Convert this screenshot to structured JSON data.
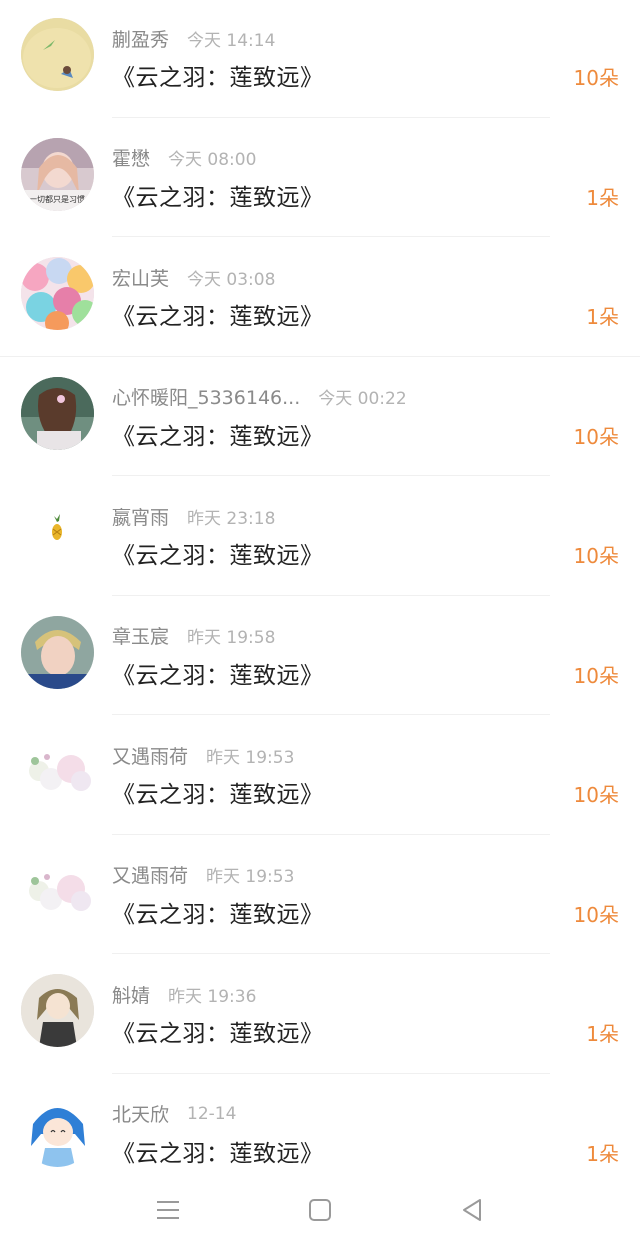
{
  "items": [
    {
      "name": "蒯盈秀",
      "time": "今天 14:14",
      "book": "《云之羽：莲致远》",
      "amount": "10朵",
      "avatar": "avatar-yellow-photo-icon"
    },
    {
      "name": "霍懋",
      "time": "今天 08:00",
      "book": "《云之羽：莲致远》",
      "amount": "1朵",
      "avatar": "avatar-girl-photo-icon"
    },
    {
      "name": "宏山芙",
      "time": "今天 03:08",
      "book": "《云之羽：莲致远》",
      "amount": "1朵",
      "avatar": "avatar-balloons-icon"
    },
    {
      "name": "心怀暖阳_5336146...",
      "time": "今天 00:22",
      "book": "《云之羽：莲致远》",
      "amount": "10朵",
      "avatar": "avatar-girl-back-icon"
    },
    {
      "name": "嬴宵雨",
      "time": "昨天 23:18",
      "book": "《云之羽：莲致远》",
      "amount": "10朵",
      "avatar": "avatar-pineapple-icon"
    },
    {
      "name": "章玉宸",
      "time": "昨天 19:58",
      "book": "《云之羽：莲致远》",
      "amount": "10朵",
      "avatar": "avatar-boy-photo-icon"
    },
    {
      "name": "又遇雨荷",
      "time": "昨天 19:53",
      "book": "《云之羽：莲致远》",
      "amount": "10朵",
      "avatar": "avatar-flowers-icon"
    },
    {
      "name": "又遇雨荷",
      "time": "昨天 19:53",
      "book": "《云之羽：莲致远》",
      "amount": "10朵",
      "avatar": "avatar-flowers-icon"
    },
    {
      "name": "斛婧",
      "time": "昨天 19:36",
      "book": "《云之羽：莲致远》",
      "amount": "1朵",
      "avatar": "avatar-anime-girl-icon"
    },
    {
      "name": "北天欣",
      "time": "12-14",
      "book": "《云之羽：莲致远》",
      "amount": "1朵",
      "avatar": "avatar-blue-anime-icon"
    }
  ],
  "colors": {
    "amount": "#ee8a3c",
    "name": "#8a8a8a",
    "time": "#b3b3b3",
    "title": "#222222"
  },
  "navbar": {
    "icons": [
      "menu-icon",
      "home-square-icon",
      "back-triangle-icon"
    ]
  }
}
